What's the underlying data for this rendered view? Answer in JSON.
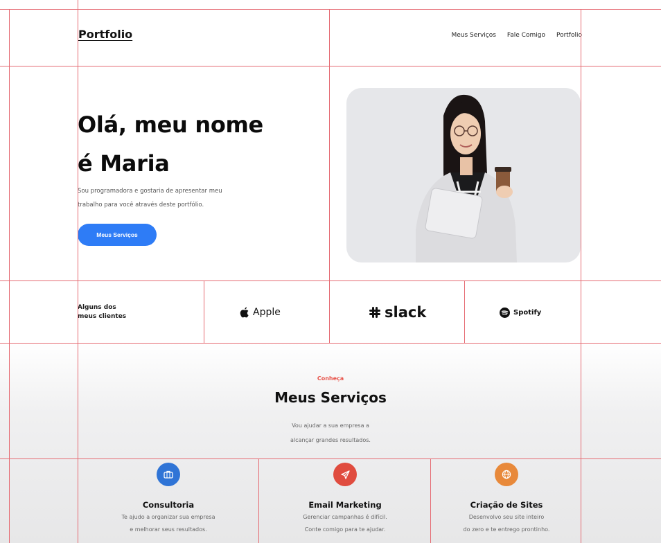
{
  "header": {
    "logo": "Portfolio",
    "nav": [
      "Meus Serviços",
      "Fale Comigo",
      "Portfolio"
    ]
  },
  "hero": {
    "title_line1": "Olá, meu nome",
    "title_line2": "é Maria",
    "desc_line1": "Sou programadora e gostaria de apresentar meu",
    "desc_line2": "trabalho para você através deste portfólio.",
    "button": "Meus Serviços"
  },
  "clients": {
    "label_line1": "Alguns dos",
    "label_line2": "meus clientes",
    "logos": [
      "Apple",
      "slack",
      "Spotify"
    ]
  },
  "services": {
    "eyebrow": "Conheça",
    "title": "Meus Serviços",
    "sub_line1": "Vou ajudar a sua empresa a",
    "sub_line2": "alcançar grandes resultados.",
    "items": [
      {
        "title": "Consultoria",
        "line1": "Te ajudo a organizar sua empresa",
        "line2": "e melhorar seus resultados.",
        "icon": "briefcase-icon",
        "color": "#2f74d6"
      },
      {
        "title": "Email Marketing",
        "line1": "Gerenciar campanhas é difícil.",
        "line2": "Conte comigo para te ajudar.",
        "icon": "paper-plane-icon",
        "color": "#e04c3f"
      },
      {
        "title": "Criação de Sites",
        "line1": "Desenvolvo seu site inteiro",
        "line2": "do zero e te entrego prontinho.",
        "icon": "globe-icon",
        "color": "#e8893a"
      }
    ]
  },
  "colors": {
    "accent": "#2e7cf6",
    "eyebrow": "#e8544b",
    "guide": "#e56a72"
  }
}
